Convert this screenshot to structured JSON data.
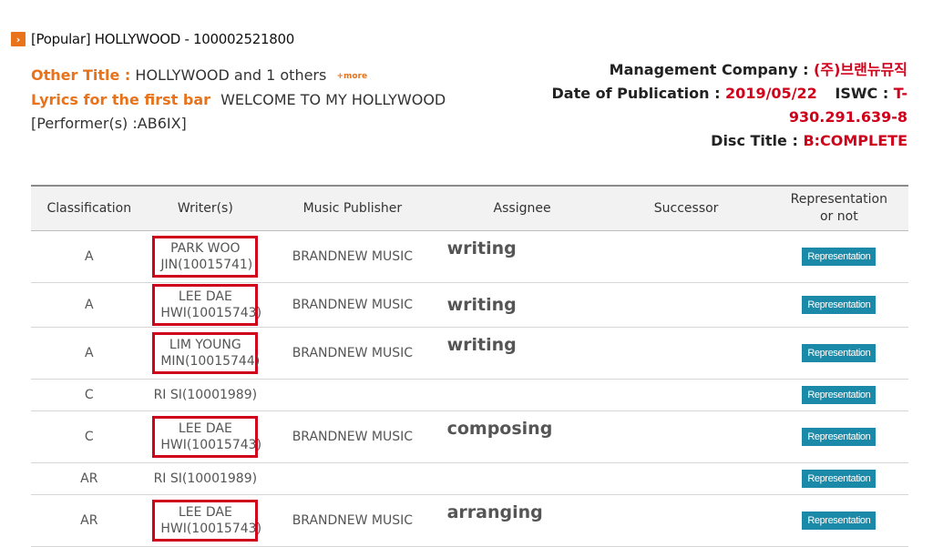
{
  "header": {
    "icon": "chevron-right-icon",
    "title": "[Popular] HOLLYWOOD - 100002521800"
  },
  "info_left": {
    "other_title_label": "Other Title :",
    "other_title_value": "HOLLYWOOD and 1 others",
    "more_label": "+more",
    "lyrics_label": "Lyrics for the first bar",
    "lyrics_value": "WELCOME TO MY HOLLYWOOD",
    "performer": "[Performer(s) :AB6IX]"
  },
  "info_right": {
    "management_label": "Management Company :",
    "management_value": "(주)브랜뉴뮤직",
    "publication_label": "Date of Publication :",
    "publication_value": "2019/05/22",
    "iswc_label": "ISWC :",
    "iswc_value_1": "T-",
    "iswc_value_2": "930.291.639-8",
    "disc_label": "Disc Title :",
    "disc_value": "B:COMPLETE"
  },
  "table": {
    "headers": {
      "classification": "Classification",
      "writers": "Writer(s)",
      "publisher": "Music Publisher",
      "assignee": "Assignee",
      "successor": "Successor",
      "representation_1": "Representation",
      "representation_2": "or not"
    },
    "rows": [
      {
        "classification": "A",
        "writer_1": "PARK WOO",
        "writer_2": "JIN(10015741)",
        "publisher": "BRANDNEW MUSIC",
        "role": "writing",
        "button": "Representation"
      },
      {
        "classification": "A",
        "writer_1": "LEE DAE",
        "writer_2": "HWI(10015743)",
        "publisher": "BRANDNEW MUSIC",
        "role": "writing",
        "button": "Representation"
      },
      {
        "classification": "A",
        "writer_1": "LIM YOUNG",
        "writer_2": "MIN(10015744)",
        "publisher": "BRANDNEW MUSIC",
        "role": "writing",
        "button": "Representation"
      },
      {
        "classification": "C",
        "writer_1": "RI SI(10001989)",
        "button": "Representation"
      },
      {
        "classification": "C",
        "writer_1": "LEE DAE",
        "writer_2": "HWI(10015743)",
        "publisher": "BRANDNEW MUSIC",
        "role": "composing",
        "button": "Representation"
      },
      {
        "classification": "AR",
        "writer_1": "RI SI(10001989)",
        "button": "Representation"
      },
      {
        "classification": "AR",
        "writer_1": "LEE DAE",
        "writer_2": "HWI(10015743)",
        "publisher": "BRANDNEW MUSIC",
        "role": "arranging",
        "button": "Representation"
      }
    ]
  },
  "colors": {
    "accent_orange": "#e8731b",
    "highlight_red": "#d0021b",
    "button_teal": "#1b8aa8"
  }
}
